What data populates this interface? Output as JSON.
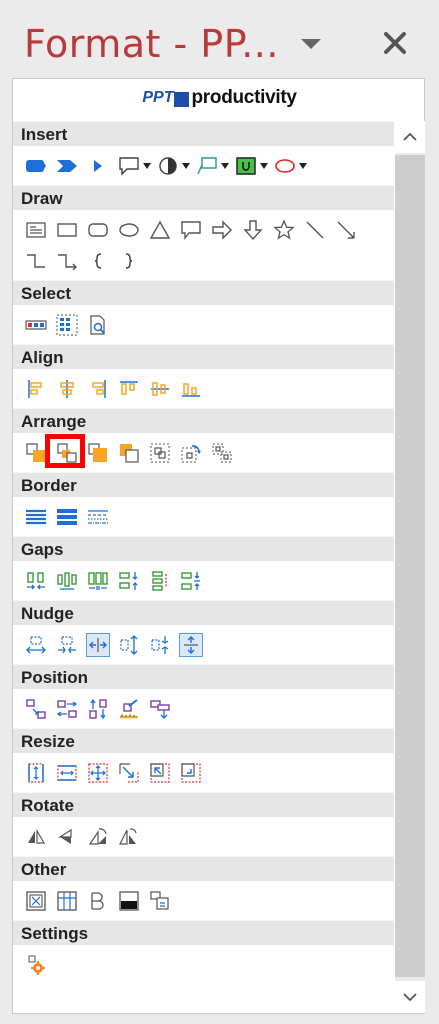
{
  "pane": {
    "title": "Format - PP...",
    "dropdown_icon": "chevron-down-icon",
    "close_icon": "close-icon"
  },
  "logo": {
    "ppt": "PPT",
    "word": "productivity"
  },
  "groups": [
    {
      "label": "Insert",
      "icons": [
        "rounded-rectangle-icon",
        "chevron-shape-icon",
        "triangle-right-icon",
        "speech-bubble-icon",
        "pie-shape-icon",
        "callout-icon",
        "green-box-icon",
        "red-oval-icon"
      ]
    },
    {
      "label": "Draw",
      "icons": [
        "text-box-icon",
        "rectangle-icon",
        "rounded-rectangle-outline-icon",
        "oval-icon",
        "triangle-icon",
        "callout-outline-icon",
        "arrow-right-icon",
        "arrow-down-icon",
        "star-icon",
        "line-icon",
        "arrow-line-icon",
        "elbow-connector-icon",
        "elbow-arrow-icon",
        "left-brace-icon",
        "right-brace-icon"
      ]
    },
    {
      "label": "Select",
      "icons": [
        "select-same-color-icon",
        "select-grid-icon",
        "select-search-icon"
      ]
    },
    {
      "label": "Align",
      "icons": [
        "align-left-icon",
        "align-center-icon",
        "align-right-icon",
        "align-top-icon",
        "align-middle-icon",
        "align-bottom-icon"
      ]
    },
    {
      "label": "Arrange",
      "icons": [
        "bring-forward-icon",
        "send-backward-icon",
        "bring-to-front-icon",
        "send-to-back-icon",
        "group-icon",
        "rotate-group-icon",
        "ungroup-icon"
      ]
    },
    {
      "label": "Border",
      "icons": [
        "border-thin-icon",
        "border-thick-icon",
        "border-dashed-icon"
      ]
    },
    {
      "label": "Gaps",
      "icons": [
        "gap-horizontal-icon",
        "gap-equal-icon",
        "gap-distribute-icon",
        "gap-vertical-icon",
        "gap-stack-icon",
        "gap-compress-icon"
      ]
    },
    {
      "label": "Nudge",
      "icons": [
        "nudge-expand-h-icon",
        "nudge-contract-h-icon",
        "nudge-left-right-icon",
        "nudge-expand-v-icon",
        "nudge-contract-v-icon",
        "nudge-up-down-icon"
      ]
    },
    {
      "label": "Position",
      "icons": [
        "swap-diagonal-icon",
        "swap-horizontal-icon",
        "swap-vertical-icon",
        "position-ruler-icon",
        "position-copy-icon"
      ]
    },
    {
      "label": "Resize",
      "icons": [
        "resize-height-icon",
        "resize-width-icon",
        "resize-both-icon",
        "resize-corner-icon",
        "resize-shrink-icon",
        "resize-fit-icon"
      ]
    },
    {
      "label": "Rotate",
      "icons": [
        "rotate-left-icon",
        "flip-icon",
        "rotate-right-icon",
        "rotate-free-icon"
      ]
    },
    {
      "label": "Other",
      "icons": [
        "picture-frame-icon",
        "table-grid-icon",
        "text-columns-icon",
        "fill-dark-icon",
        "duplicate-icon"
      ]
    },
    {
      "label": "Settings",
      "icons": [
        "settings-gear-icon"
      ]
    }
  ],
  "colors": {
    "title": "#b83b3b",
    "blue": "#1e6fd9",
    "orange": "#f5a623",
    "green": "#46a046",
    "purple": "#7b3fb0",
    "red_highlight": "#ff0000"
  }
}
